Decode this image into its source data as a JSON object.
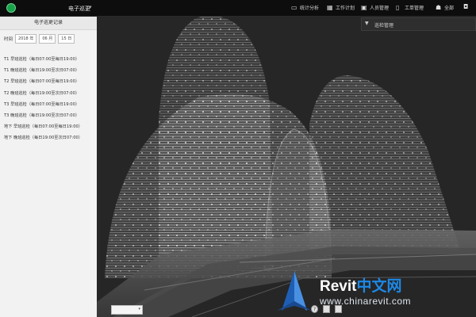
{
  "header": {
    "title": "电子巡更",
    "nav": [
      {
        "label": "统计分析",
        "icon": "monitor-icon"
      },
      {
        "label": "工作计划",
        "icon": "calendar-icon"
      },
      {
        "label": "人员管理",
        "icon": "id-card-icon"
      },
      {
        "label": "工单管理",
        "icon": "document-icon"
      },
      {
        "label": "全部",
        "icon": "people-icon"
      },
      {
        "label": "",
        "icon": "camera-icon"
      }
    ]
  },
  "sidebar": {
    "title": "电子巡更记录",
    "time_label": "时间",
    "year": "2018 年",
    "month": "06 月",
    "day": "15 日",
    "records": [
      "T1 早班巡检（每日07:00至每日19:00）",
      "T1 晚班巡检（每日19:00至次日07:00）",
      "T2 早班巡检（每日07:00至每日19:00）",
      "T2 晚班巡检（每日19:00至次日07:00）",
      "T3 早班巡检（每日07:00至每日19:00）",
      "T3 晚班巡检（每日19:00至次日07:00）",
      "地下 早班巡检（每日07:00至每日19:00）",
      "地下 晚班巡检（每日19:00至次日07:00）"
    ]
  },
  "viewport": {
    "panel_label": "巡检管理"
  },
  "watermark": {
    "brand": "Revit",
    "brand_cn": "中文网",
    "url": "www.chinarevit.com"
  }
}
